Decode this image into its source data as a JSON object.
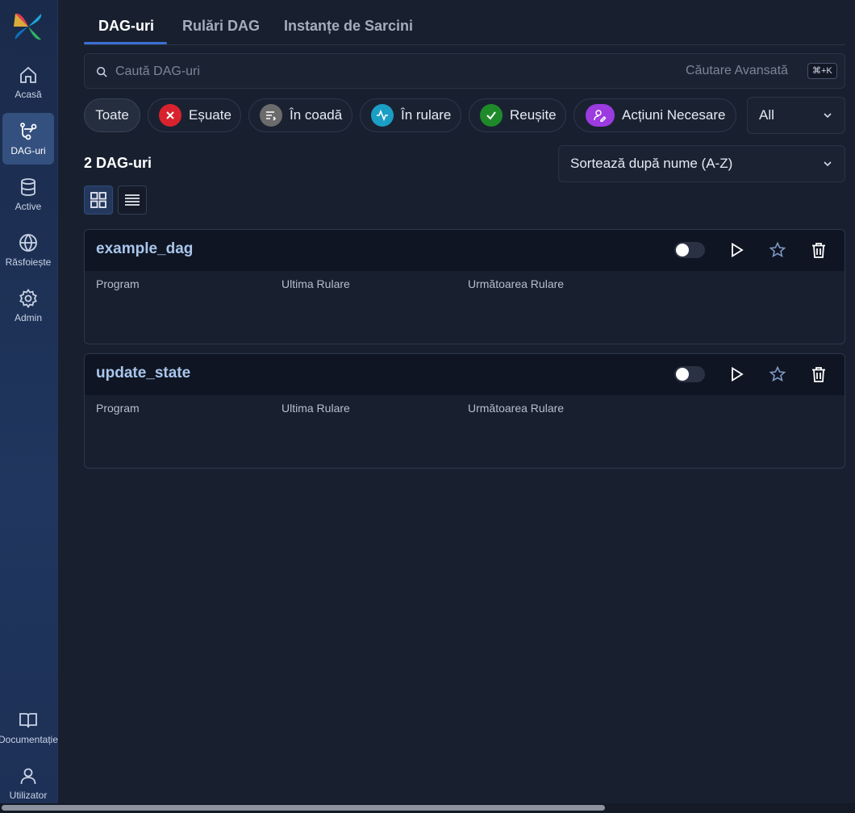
{
  "sidebar": {
    "items": [
      {
        "label": "Acasă",
        "icon": "home-icon"
      },
      {
        "label": "DAG-uri",
        "icon": "dag-icon"
      },
      {
        "label": "Active",
        "icon": "database-icon"
      },
      {
        "label": "Răsfoiește",
        "icon": "globe-icon"
      },
      {
        "label": "Admin",
        "icon": "gear-icon"
      }
    ],
    "bottom_items": [
      {
        "label": "Documentație",
        "icon": "book-icon"
      },
      {
        "label": "Utilizator",
        "icon": "user-icon"
      }
    ],
    "active_index": 1
  },
  "tabs": [
    {
      "label": "DAG-uri"
    },
    {
      "label": "Rulări DAG"
    },
    {
      "label": "Instanțe de Sarcini"
    }
  ],
  "search": {
    "placeholder": "Caută DAG-uri",
    "value": "",
    "advanced_label": "Căutare Avansată",
    "shortcut": "⌘+K"
  },
  "filters": {
    "chips": [
      {
        "label": "Toate"
      },
      {
        "label": "Eșuate",
        "icon": "x-icon",
        "color": "#d8232e"
      },
      {
        "label": "În coadă",
        "icon": "queue-icon",
        "color": "#6b6b6b"
      },
      {
        "label": "În rulare",
        "icon": "activity-icon",
        "color": "#1b9ec4"
      },
      {
        "label": "Reușite",
        "icon": "check-icon",
        "color": "#1f8a2a"
      },
      {
        "label": "Acțiuni Necesare",
        "icon": "user-edit-icon",
        "color": "#9b3be0"
      }
    ],
    "selected": "Toate",
    "dropdown_value": "All"
  },
  "list": {
    "count_label": "2 DAG-uri",
    "sort_label": "Sortează după nume (A-Z)",
    "view_mode": "grid"
  },
  "dags": [
    {
      "name": "example_dag",
      "paused": true,
      "columns": {
        "schedule": "Program",
        "last_run": "Ultima Rulare",
        "next_run": "Următoarea Rulare"
      }
    },
    {
      "name": "update_state",
      "paused": true,
      "columns": {
        "schedule": "Program",
        "last_run": "Ultima Rulare",
        "next_run": "Următoarea Rulare"
      }
    }
  ],
  "colors": {
    "accent": "#3b6fd1",
    "dag_title": "#a9c6ec",
    "background": "#18202f"
  }
}
